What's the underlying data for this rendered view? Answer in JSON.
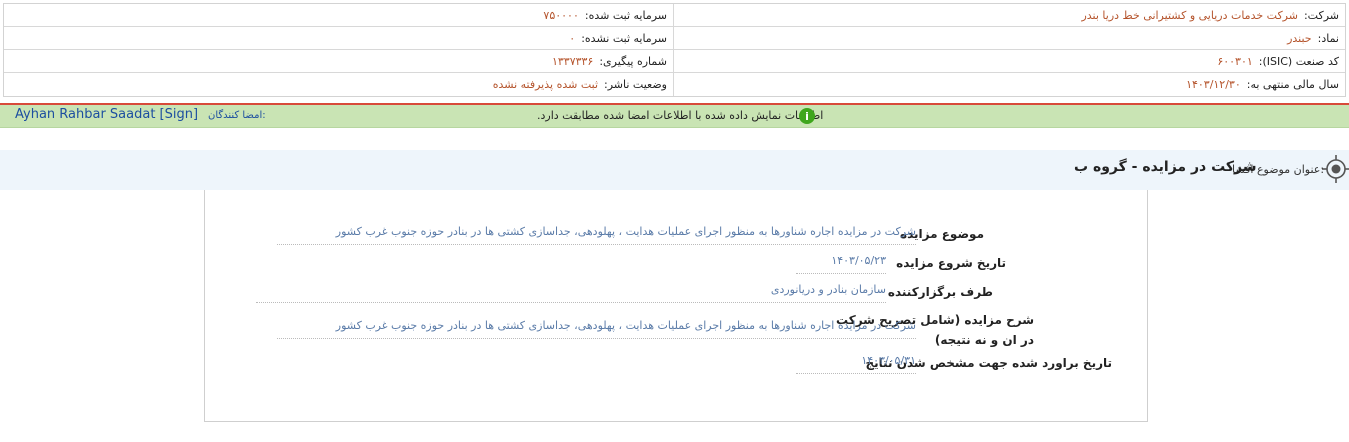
{
  "company_info": {
    "company_label": "شرکت:",
    "company_value": "شرکت خدمات دریایی و کشتیرانی خط دریا بندر",
    "symbol_label": "نماد:",
    "symbol_value": "حبندر",
    "isic_label": "کد صنعت (ISIC):",
    "isic_value": "۶۰۰۳۰۱",
    "fiscal_label": "سال مالی منتهی به:",
    "fiscal_value": "۱۴۰۳/۱۲/۳۰",
    "reg_capital_label": "سرمایه ثبت شده:",
    "reg_capital_value": "۷۵۰۰۰۰",
    "unreg_capital_label": "سرمایه ثبت نشده:",
    "unreg_capital_value": "۰",
    "tracking_label": "شماره پیگیری:",
    "tracking_value": "۱۳۳۷۳۳۶",
    "status_label": "وضعیت ناشر:",
    "status_value": "ثبت شده پذیرفته نشده"
  },
  "signers": {
    "label": "امضا کنندگان:",
    "name": "Ayhan Rahbar Saadat [Sign]",
    "verify_message": "اطلاعات نمایش داده شده با اطلاعات امضا شده مطابقت دارد."
  },
  "subject": {
    "label": "عنوان موضوع افشا:",
    "title": "شرکت در مزایده - گروه ب"
  },
  "rows": [
    {
      "label": "موضوع مزایده",
      "value": "شرکت در مزایده اجاره شناورها به منظور اجرای عملیات هدایت ، پهلودهی، جداسازی کشتی ها در بنادر حوزه جنوب غرب کشور"
    },
    {
      "label": "تاریخ شروع مزایده",
      "value": "۱۴۰۳/۰۵/۲۳"
    },
    {
      "label": "طرف برگزارکننده",
      "value": "سازمان بنادر و دریانوردی"
    },
    {
      "label": "شرح مزایده (شامل تصریح شرکت در ان و نه نتیجه)",
      "value": "شرکت در مزایده اجاره شناورها به منظور اجرای عملیات هدایت ، پهلودهی، جداسازی کشتی ها در بنادر حوزه جنوب غرب کشور"
    },
    {
      "label": "تاریخ براورد شده جهت مشخص شدن نتایج",
      "value": "۱۴۰۳/۰۵/۳۱"
    }
  ],
  "colors": {
    "value_text": "#b5542c",
    "link_blue": "#1d4fa0",
    "green_bar": "#c9e4b4",
    "accent_red": "#d84a3a"
  }
}
